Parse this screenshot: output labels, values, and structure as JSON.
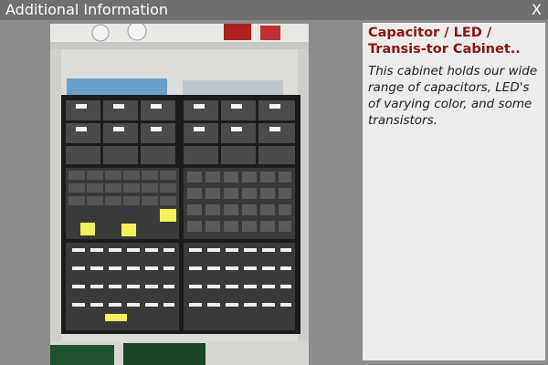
{
  "dialog": {
    "title": "Additional Information",
    "close_label": "X"
  },
  "info": {
    "heading": "Capacitor / LED / Transis-tor Cabinet..",
    "description": "This cabinet holds our wide range of capacitors, LED's of varying color, and some transistors."
  },
  "colors": {
    "titlebar": "#6f6f6f",
    "background": "#8c8c8c",
    "heading": "#8a1515",
    "info_panel": "#ececec"
  }
}
